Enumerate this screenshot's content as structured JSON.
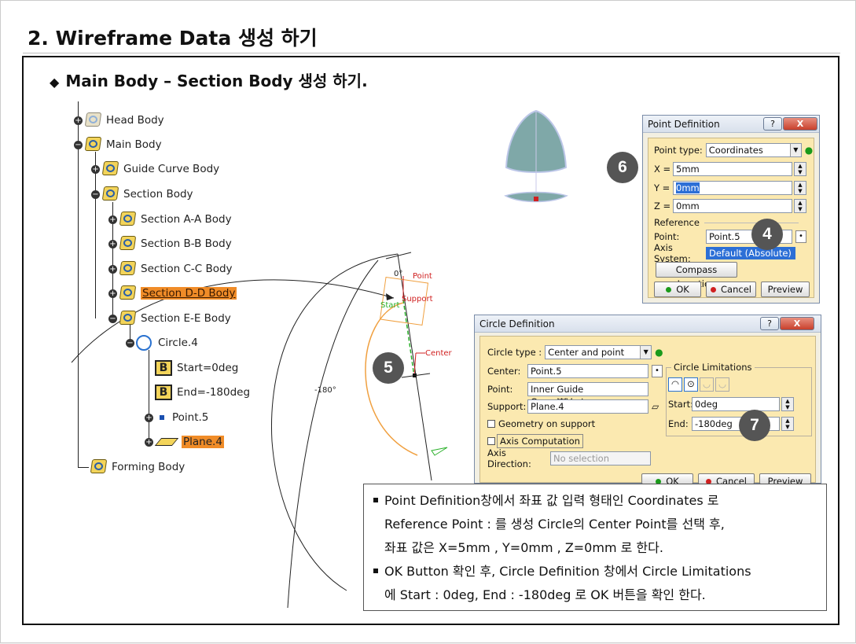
{
  "page": {
    "title": "2. Wireframe Data 생성 하기",
    "subtitle": "Main Body – Section Body 생성 하기."
  },
  "tree": {
    "items": [
      {
        "label": "Head Body"
      },
      {
        "label": "Main Body"
      },
      {
        "label": "Guide Curve Body"
      },
      {
        "label": "Section Body"
      },
      {
        "label": "Section A-A Body"
      },
      {
        "label": "Section B-B Body"
      },
      {
        "label": "Section C-C Body"
      },
      {
        "label": "Section D-D Body"
      },
      {
        "label": "Section E-E Body"
      },
      {
        "label": "Circle.4"
      },
      {
        "label": "Start=0deg"
      },
      {
        "label": "End=-180deg"
      },
      {
        "label": "Point.5"
      },
      {
        "label": "Plane.4"
      },
      {
        "label": "Forming Body"
      }
    ]
  },
  "viewport": {
    "label_point": "Point",
    "label_support": "Support",
    "label_start": "Start",
    "label_center": "Center",
    "label_zero": "0°",
    "label_minus180": "-180°"
  },
  "point_dialog": {
    "title": "Point Definition",
    "help": "?",
    "close": "X",
    "point_type_label": "Point type:",
    "point_type_value": "Coordinates",
    "x_label": "X =",
    "x_value": "5mm",
    "y_label": "Y =",
    "y_value": "0mm",
    "z_label": "Z =",
    "z_value": "0mm",
    "reference_label": "Reference",
    "point_label": "Point:",
    "point_value": "Point.5",
    "axis_label": "Axis System:",
    "axis_value": "Default (Absolute)",
    "compass_btn": "Compass Location",
    "ok": "OK",
    "cancel": "Cancel",
    "preview": "Preview"
  },
  "circle_dialog": {
    "title": "Circle Definition",
    "help": "?",
    "close": "X",
    "circle_type_label": "Circle type :",
    "circle_type_value": "Center and point",
    "center_label": "Center:",
    "center_value": "Point.5",
    "point_label": "Point:",
    "point_value": "Inner Guide Curve₩Vertex",
    "support_label": "Support:",
    "support_value": "Plane.4",
    "geometry_label": "Geometry on support",
    "axis_comp_label": "Axis Computation",
    "axis_dir_label": "Axis Direction:",
    "axis_dir_placeholder": "No selection",
    "limitations_label": "Circle Limitations",
    "start_label": "Start:",
    "start_value": "0deg",
    "end_label": "End:",
    "end_value": "-180deg",
    "ok": "OK",
    "cancel": "Cancel",
    "preview": "Preview"
  },
  "badges": {
    "b4": "4",
    "b5": "5",
    "b6": "6",
    "b7": "7"
  },
  "note": {
    "line1": "Point Definition창에서 좌표 값 입력 형태인 Coordinates 로",
    "line2": "Reference Point : 를 생성 Circle의 Center Point를 선택 후,",
    "line3": "좌표 값은 X=5mm , Y=0mm , Z=0mm 로 한다.",
    "line4": "OK Button 확인 후, Circle Definition 창에서 Circle Limitations",
    "line5": "에 Start : 0deg, End : -180deg 로 OK 버튼을 확인 한다."
  },
  "colors": {
    "highlight": "#f08c28",
    "dialog_body": "#fbe9b0",
    "badge": "#555555",
    "selection": "#2c6fd6"
  }
}
